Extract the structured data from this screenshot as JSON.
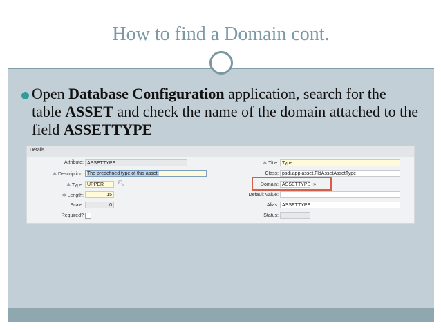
{
  "slide": {
    "title": "How to find a Domain cont.",
    "body": {
      "t1": "Open ",
      "b1": "Database Configuration",
      "t2": " application, search for the table ",
      "b2": "ASSET",
      "t3": " and check the name of the domain attached to the field ",
      "b3": "ASSETTYPE"
    }
  },
  "details": {
    "header": "Details",
    "left": {
      "attribute_label": "Attribute:",
      "attribute_value": "ASSETTYPE",
      "description_label": "Description:",
      "description_value": "The predefined type of this asset.",
      "type_label": "Type:",
      "type_value": "UPPER",
      "length_label": "Length:",
      "length_value": "15",
      "scale_label": "Scale:",
      "scale_value": "0",
      "required_label": "Required?"
    },
    "right": {
      "title_label": "Title:",
      "title_value": "Type",
      "class_label": "Class:",
      "class_value": "psdi.app.asset.FldAssetAssetType",
      "domain_label": "Domain:",
      "domain_value": "ASSETTYPE",
      "default_label": "Default Value:",
      "alias_label": "Alias:",
      "alias_value": "ASSETTYPE",
      "status_label": "Status:"
    }
  },
  "colors": {
    "title": "#7c9aa6",
    "background": "#c3cfd6",
    "bullet": "#2f9e9b",
    "highlight_border": "#d4604b"
  },
  "icons": {
    "bullet": "filled-circle",
    "lookup": "magnifier-icon",
    "detail": "double-chevron-right-icon"
  }
}
